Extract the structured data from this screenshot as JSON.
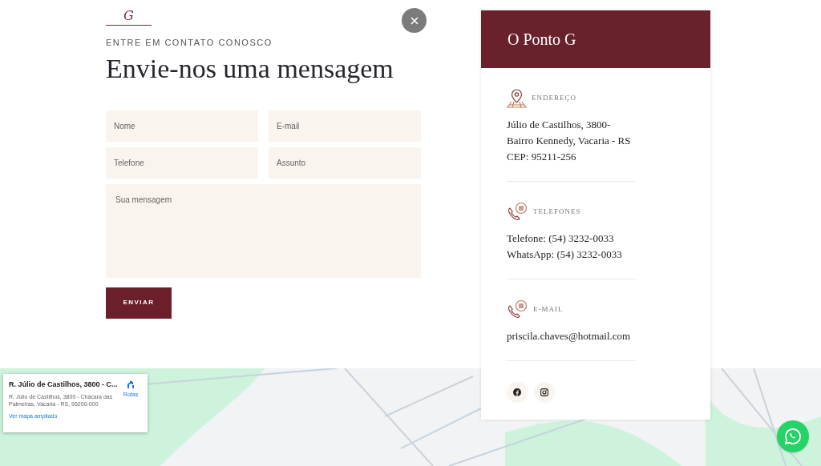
{
  "logo": {
    "letter": "G"
  },
  "eyebrow": "ENTRE EM CONTATO CONOSCO",
  "heading": "Envie-nos uma mensagem",
  "fields": [
    {
      "placeholder": "Nome",
      "kind": "input"
    },
    {
      "placeholder": "E-mail",
      "kind": "input"
    },
    {
      "placeholder": "Telefone",
      "kind": "input"
    },
    {
      "placeholder": "Assunto",
      "kind": "input"
    },
    {
      "placeholder": "Sua mensagem",
      "kind": "textarea"
    }
  ],
  "submit": "ENVIAR",
  "card": {
    "title": "O Ponto G",
    "sections": [
      {
        "kind": "pin",
        "label": "ENDEREÇO",
        "lines": [
          "Júlio de Castilhos, 3800-",
          "Bairro Kennedy, Vacaria - RS",
          "CEP: 95211-256"
        ]
      },
      {
        "kind": "phone",
        "label": "TELEFONES",
        "lines": [
          "Telefone: (54) 3232-0033",
          "WhatsApp: (54) 3232-0033"
        ]
      },
      {
        "kind": "phone",
        "label": "E-MAIL",
        "lines": [
          "priscila.chaves@hotmail.com"
        ]
      }
    ],
    "socials": [
      {
        "kind": "facebook"
      },
      {
        "kind": "instagram"
      }
    ]
  },
  "map_info": {
    "title": "R. Júlio de Castilhos, 3800 - C...",
    "address": "R. Júlio de Castilhos, 3800 - Chácara das Palmeiras, Vacaria - RS, 95200-000",
    "directions": "Rotas",
    "link": "Ver mapa ampliado"
  }
}
